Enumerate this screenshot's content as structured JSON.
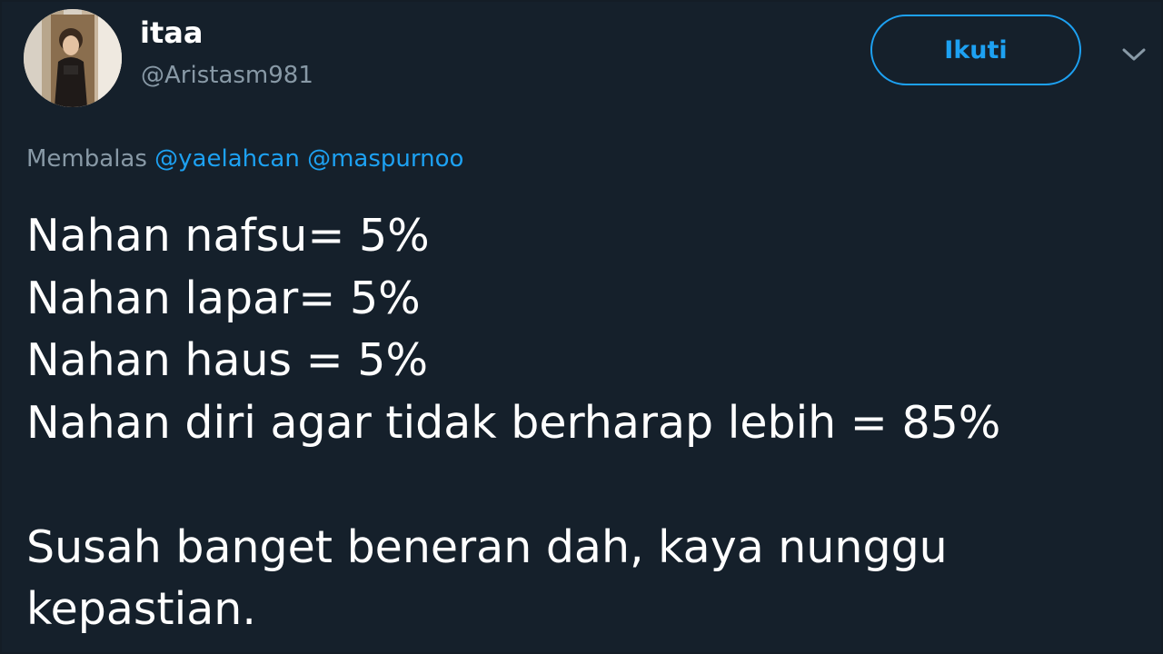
{
  "user": {
    "display_name": "itaa",
    "handle": "@Aristasm981"
  },
  "actions": {
    "follow_label": "Ikuti",
    "more_icon": "chevron-down-icon"
  },
  "reply": {
    "prefix": "Membalas",
    "mentions": [
      "@yaelahcan",
      "@maspurnoo"
    ]
  },
  "tweet": {
    "lines": [
      "Nahan nafsu= 5%",
      "Nahan lapar= 5%",
      "Nahan haus = 5%",
      "Nahan diri agar tidak berharap lebih = 85%"
    ],
    "closing_lines": [
      "Susah banget beneran dah, kaya nunggu",
      "kepastian."
    ]
  },
  "colors": {
    "background": "#15202b",
    "accent": "#1da1f2",
    "secondary_text": "#8899a6",
    "primary_text": "#ffffff"
  }
}
